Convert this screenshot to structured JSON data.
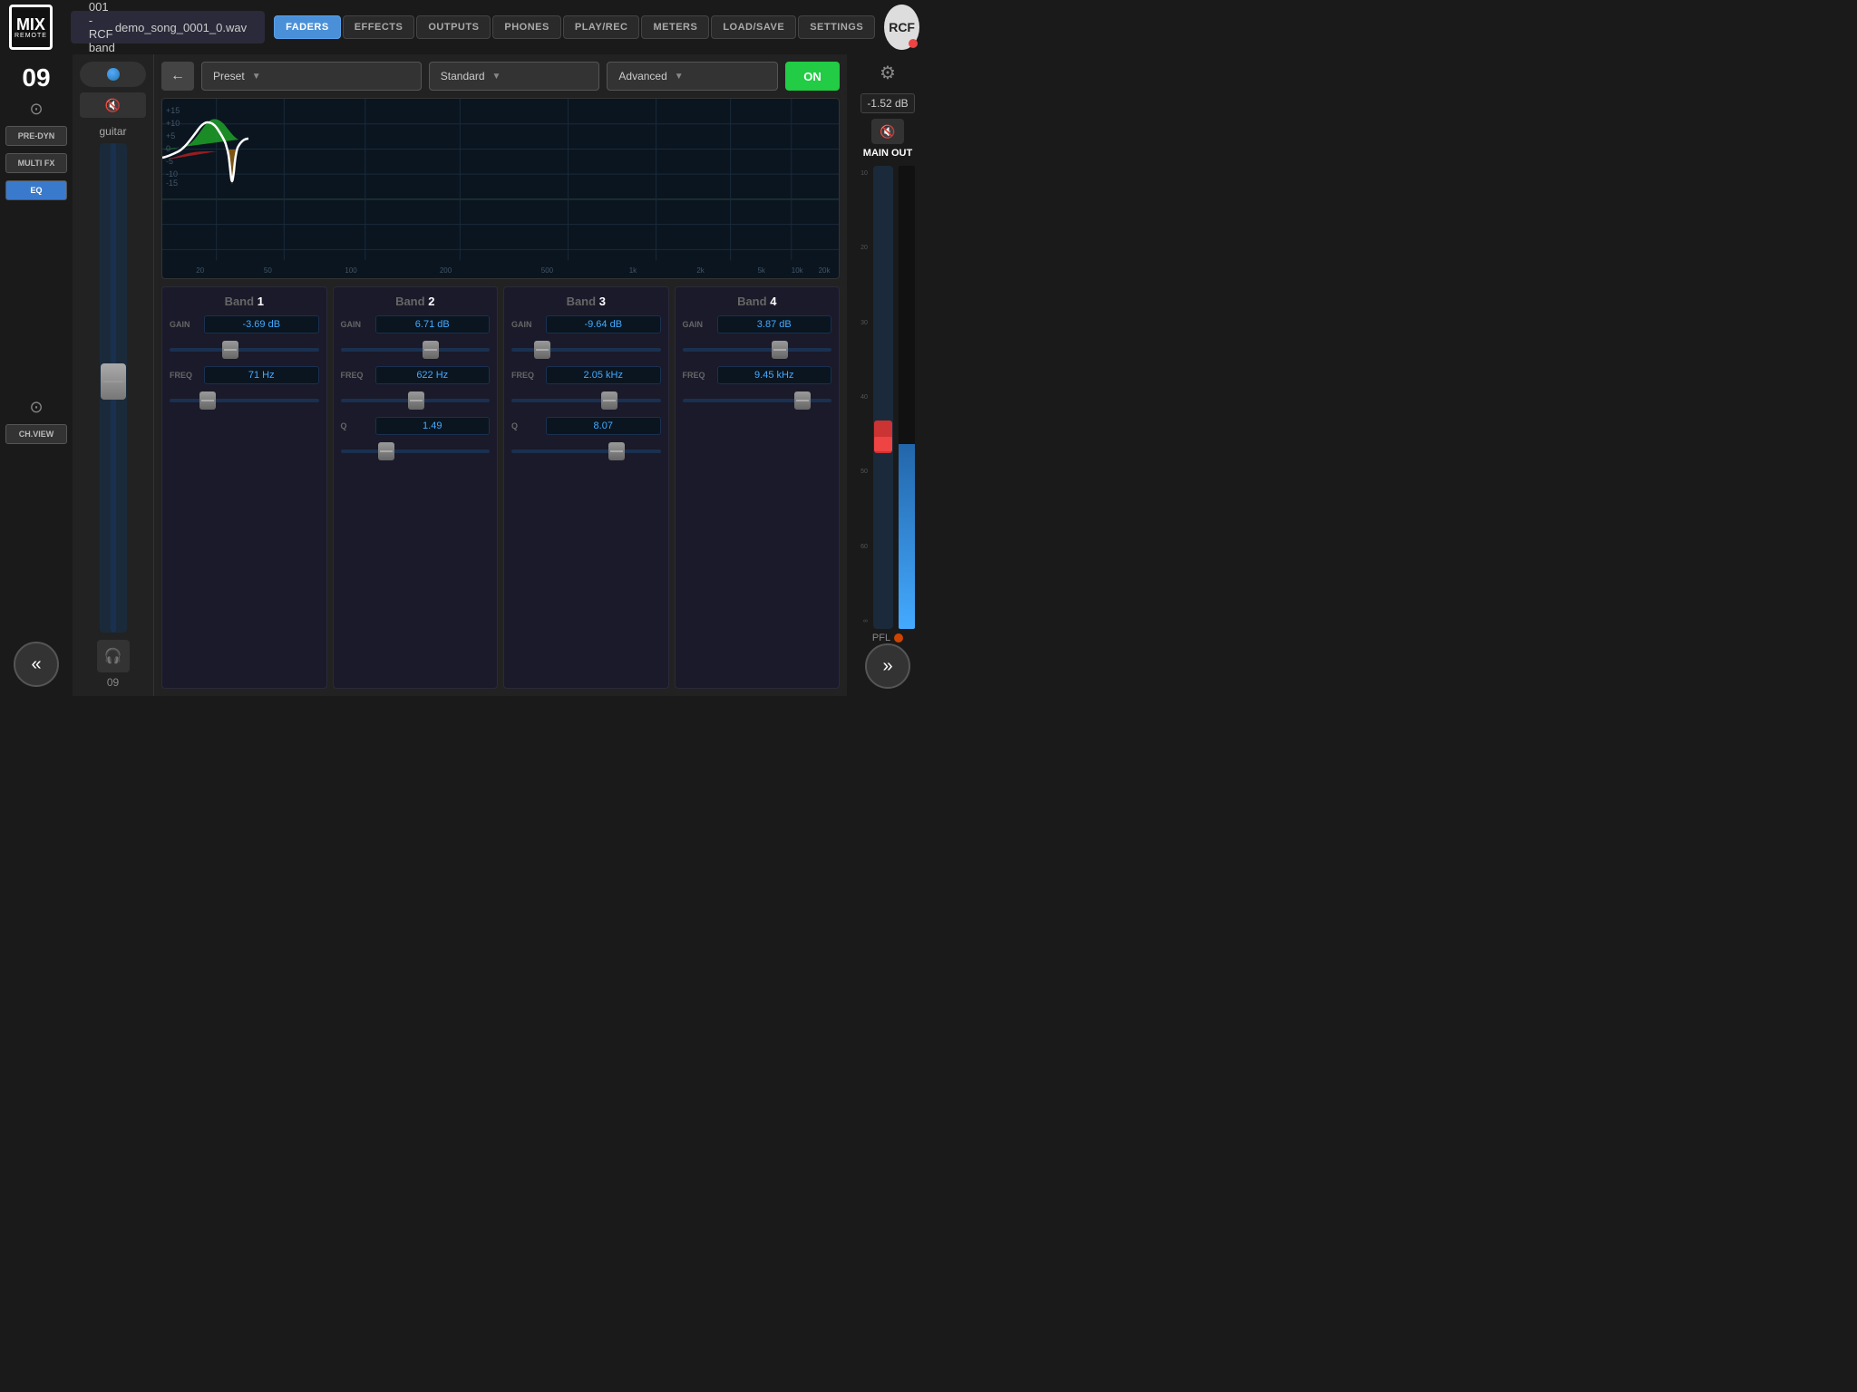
{
  "app": {
    "logo_mix": "MIX",
    "logo_remote": "REMOTE"
  },
  "header": {
    "song_name": "001 - RCF band",
    "file_name": "demo_song_0001_0.wav",
    "rcf_label": "RCF"
  },
  "nav": {
    "tabs": [
      {
        "label": "FADERS",
        "active": true
      },
      {
        "label": "EFFECTS",
        "active": false
      },
      {
        "label": "OUTPUTS",
        "active": false
      },
      {
        "label": "PHONES",
        "active": false
      },
      {
        "label": "PLAY/REC",
        "active": false
      },
      {
        "label": "METERS",
        "active": false
      },
      {
        "label": "LOAD/SAVE",
        "active": false
      },
      {
        "label": "SETTINGS",
        "active": false
      }
    ]
  },
  "left_sidebar": {
    "channel_number": "09",
    "buttons": [
      {
        "label": "PRE-DYN"
      },
      {
        "label": "MULTI FX"
      },
      {
        "label": "EQ",
        "active": true
      }
    ],
    "ch_view": "CH.VIEW"
  },
  "channel_strip": {
    "label": "guitar",
    "channel_num_bottom": "09"
  },
  "eq_toolbar": {
    "back_label": "←",
    "preset_label": "Preset",
    "preset_arrow": "▼",
    "standard_label": "Standard",
    "standard_arrow": "▼",
    "advanced_label": "Advanced",
    "advanced_arrow": "▼",
    "on_label": "ON"
  },
  "eq_display": {
    "freq_labels": [
      "20",
      "50",
      "100",
      "200",
      "500",
      "1k",
      "2k",
      "5k",
      "10k",
      "20k"
    ],
    "db_labels": [
      "+15",
      "+10",
      "+5",
      "0",
      "-5",
      "-10",
      "-15"
    ]
  },
  "bands": [
    {
      "title": "Band ",
      "num": "1",
      "gain_label": "GAIN",
      "gain_value": "-3.69 dB",
      "freq_label": "FREQ",
      "freq_value": "71 Hz",
      "has_q": false
    },
    {
      "title": "Band ",
      "num": "2",
      "gain_label": "GAIN",
      "gain_value": "6.71 dB",
      "freq_label": "FREQ",
      "freq_value": "622 Hz",
      "has_q": true,
      "q_label": "Q",
      "q_value": "1.49"
    },
    {
      "title": "Band ",
      "num": "3",
      "gain_label": "GAIN",
      "gain_value": "-9.64 dB",
      "freq_label": "FREQ",
      "freq_value": "2.05 kHz",
      "has_q": true,
      "q_label": "Q",
      "q_value": "8.07"
    },
    {
      "title": "Band ",
      "num": "4",
      "gain_label": "GAIN",
      "gain_value": "3.87 dB",
      "freq_label": "FREQ",
      "freq_value": "9.45 kHz",
      "has_q": false
    }
  ],
  "right_sidebar": {
    "db_value": "-1.52 dB",
    "main_out": "MAIN OUT",
    "pfl_label": "PFL",
    "scale": [
      "-",
      "10",
      "20",
      "30",
      "40",
      "50",
      "60",
      "∞"
    ]
  }
}
